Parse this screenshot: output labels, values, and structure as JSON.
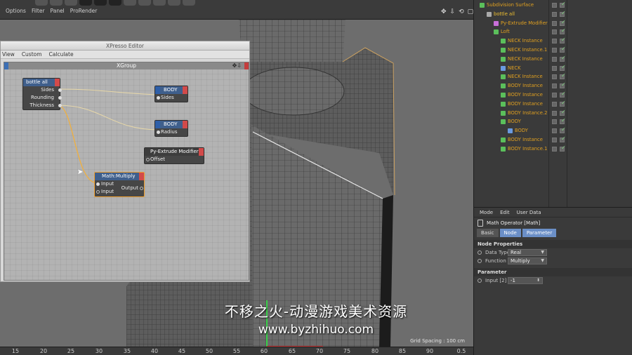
{
  "menubar": [
    "Options",
    "Filter",
    "Panel",
    "ProRender"
  ],
  "viewport": {
    "grid_spacing": "Grid Spacing : 100 cm",
    "nav_icons": [
      "✥",
      "⇩",
      "⟲",
      "▢"
    ],
    "ruler_ticks": [
      "15",
      "20",
      "25",
      "30",
      "35",
      "40",
      "45",
      "50",
      "55",
      "60",
      "65",
      "70",
      "75",
      "80",
      "85",
      "90",
      "0.5"
    ]
  },
  "xpresso": {
    "window_title": "XPresso Editor",
    "menu": [
      "View",
      "Custom",
      "Calculate"
    ],
    "group_title": "XGroup",
    "nodes": {
      "bottle": {
        "title": "bottle all",
        "ports": [
          "Sides",
          "Rounding",
          "Thickness"
        ]
      },
      "body1": {
        "title": "BODY",
        "ports": [
          "Sides"
        ]
      },
      "body2": {
        "title": "BODY",
        "ports": [
          "Radius"
        ]
      },
      "pyextrude": {
        "title": "Py-Extrude Modifier",
        "ports": [
          "Offset"
        ]
      },
      "math": {
        "title": "Math:Multiply",
        "in_ports": [
          "Input",
          "Input"
        ],
        "out_ports": [
          "Output"
        ]
      }
    }
  },
  "objects": [
    {
      "name": "Subdivision Surface",
      "indent": 0,
      "color": "#e0a020",
      "icon": "#5bbf5b"
    },
    {
      "name": "bottle all",
      "indent": 1,
      "color": "#f0c030",
      "icon": "#aaaaaa"
    },
    {
      "name": "Py-Extrude Modifier",
      "indent": 2,
      "color": "#e0a020",
      "icon": "#c86fd8"
    },
    {
      "name": "Loft",
      "indent": 2,
      "color": "#e0a020",
      "icon": "#5bbf5b"
    },
    {
      "name": "NECK Instance",
      "indent": 3,
      "color": "#e0a020",
      "icon": "#5bbf5b"
    },
    {
      "name": "NECK Instance.1",
      "indent": 3,
      "color": "#e0a020",
      "icon": "#5bbf5b"
    },
    {
      "name": "NECK Instance",
      "indent": 3,
      "color": "#e0a020",
      "icon": "#5bbf5b"
    },
    {
      "name": "NECK",
      "indent": 3,
      "color": "#e0a020",
      "icon": "#6a9ae0"
    },
    {
      "name": "NECK Instance",
      "indent": 3,
      "color": "#e0a020",
      "icon": "#5bbf5b"
    },
    {
      "name": "BODY Instance",
      "indent": 3,
      "color": "#e0a020",
      "icon": "#5bbf5b"
    },
    {
      "name": "BODY Instance",
      "indent": 3,
      "color": "#e0a020",
      "icon": "#5bbf5b"
    },
    {
      "name": "BODY Instance",
      "indent": 3,
      "color": "#e0a020",
      "icon": "#5bbf5b"
    },
    {
      "name": "BODY Instance.2",
      "indent": 3,
      "color": "#e0a020",
      "icon": "#5bbf5b"
    },
    {
      "name": "BODY",
      "indent": 3,
      "color": "#e0a020",
      "icon": "#5bbf5b"
    },
    {
      "name": "BODY",
      "indent": 4,
      "color": "#e0a020",
      "icon": "#6a9ae0"
    },
    {
      "name": "BODY Instance",
      "indent": 3,
      "color": "#e0a020",
      "icon": "#5bbf5b"
    },
    {
      "name": "BODY Instance.1",
      "indent": 3,
      "color": "#e0a020",
      "icon": "#5bbf5b"
    }
  ],
  "attributes": {
    "menu": [
      "Mode",
      "Edit",
      "User Data"
    ],
    "title": "Math Operator [Math]",
    "tabs": [
      "Basic",
      "Node",
      "Parameter"
    ],
    "section_node": "Node Properties",
    "data_type_label": "Data Type",
    "data_type_value": "Real",
    "function_label": "Function",
    "function_value": "Multiply",
    "section_param": "Parameter",
    "input_label": "Input [2]",
    "input_value": "-1"
  },
  "watermark": {
    "line1": "不移之火-动漫游戏美术资源",
    "line2": "www.byzhihuo.com"
  }
}
